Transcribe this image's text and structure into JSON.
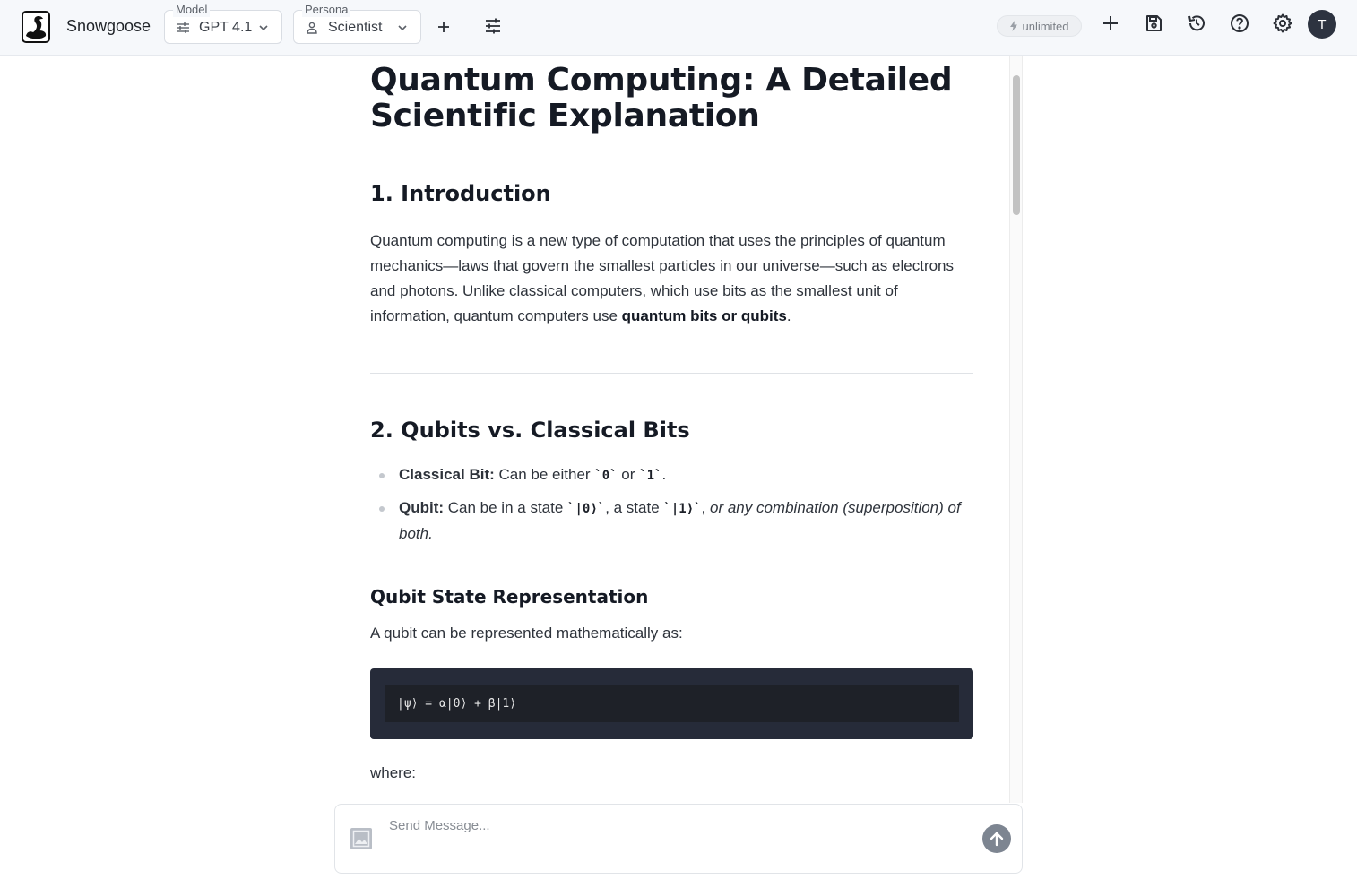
{
  "header": {
    "app_name": "Snowgoose",
    "model": {
      "label": "Model",
      "value": "GPT 4.1"
    },
    "persona": {
      "label": "Persona",
      "value": "Scientist"
    },
    "usage_badge": "unlimited",
    "avatar_initial": "T"
  },
  "content": {
    "title": "Quantum Computing: A Detailed Scientific Explanation",
    "intro_heading": "1. Introduction",
    "intro_text_1": "Quantum computing is a new type of computation that uses the principles of quantum mechanics—laws that govern the smallest particles in our universe—such as electrons and photons. Unlike classical computers, which use bits as the smallest unit of information, quantum computers use ",
    "intro_bold": "quantum bits or qubits",
    "intro_text_2": ".",
    "qubits_heading": "2. Qubits vs. Classical Bits",
    "bullets": {
      "classical_label": "Classical Bit:",
      "classical_text": " Can be either ",
      "classical_code_0": "`0`",
      "classical_or": " or ",
      "classical_code_1": "`1`",
      "classical_end": ".",
      "qubit_label": "Qubit:",
      "qubit_text": " Can be in a state ",
      "qubit_code_0": "`|0⟩`",
      "qubit_mid": ", a state ",
      "qubit_code_1": "`|1⟩`",
      "qubit_comma": ", ",
      "qubit_italic": "or any combination (superposition) of both."
    },
    "state_heading": "Qubit State Representation",
    "state_text": "A qubit can be represented mathematically as:",
    "code": "|ψ⟩ = α|0⟩ + β|1⟩",
    "where_text": "where:"
  },
  "composer": {
    "placeholder": "Send Message..."
  },
  "icons": {
    "logo": "goose-logo-icon",
    "model": "sliders-icon",
    "persona": "person-icon",
    "new": "plus-icon",
    "settings_tune": "tune-icon",
    "save": "save-icon",
    "history": "history-icon",
    "help": "help-circle-icon",
    "gear": "gear-icon",
    "bolt": "bolt-icon",
    "image": "image-icon",
    "send": "arrow-up-icon"
  }
}
